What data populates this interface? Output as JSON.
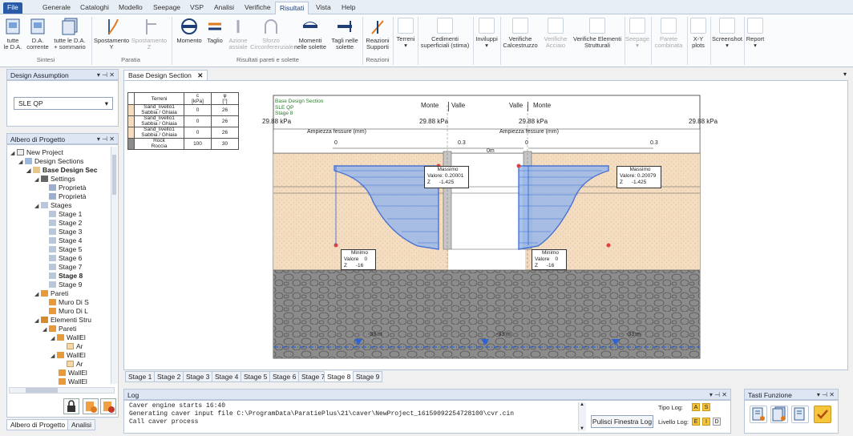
{
  "ribbon_tabs": [
    "File",
    "Generale",
    "Cataloghi",
    "Modello",
    "Seepage",
    "VSP",
    "Analisi",
    "Verifiche",
    "Risultati",
    "Vista",
    "Help"
  ],
  "active_tab": "Risultati",
  "ribbon": {
    "sintesi": {
      "group": "Sintesi",
      "b1": "tutte\nle D.A.",
      "b2": "D.A.\ncorrente",
      "b3": "tutte le D.A.\n+ sommario"
    },
    "paratia": {
      "group": "Paratia",
      "b1": "Spostamento\nY",
      "b2": "Spostamento\nZ"
    },
    "risultati": {
      "group": "Risultati pareti e solette",
      "b1": "Momento",
      "b2": "Taglio",
      "b3": "Azione\nassiale",
      "b4": "Sforzo\nCirconferenziale",
      "b5": "Momenti\nnelle solette",
      "b6": "Tagli nelle\nsolette"
    },
    "reazioni": {
      "group": "Reazioni",
      "b1": "Reazioni\nSupporti"
    },
    "others": [
      "Terreni",
      "Cedimenti\nsuperficiali (stima)",
      "Inviluppi",
      "Verifiche\nCalcestruzzo",
      "Verifiche\nAcciaio",
      "Verifiche Elementi\nStrutturali",
      "Seepage",
      "Parete\ncombinata",
      "X-Y\nplots",
      "Screenshot",
      "Report"
    ]
  },
  "design_assumption": {
    "title": "Design Assumption",
    "value": "SLE QP"
  },
  "tree": {
    "title": "Albero di Progetto",
    "items": [
      "New Project",
      "Design Sections",
      "Base Design Sec",
      "Settings",
      "Proprietà",
      "Proprietà",
      "Stages",
      "Stage 1",
      "Stage 2",
      "Stage 3",
      "Stage 4",
      "Stage 5",
      "Stage 6",
      "Stage 7",
      "Stage 8",
      "Stage 9",
      "Pareti",
      "Muro Di S",
      "Muro Di L",
      "Elementi Stru",
      "Pareti",
      "WallEl",
      "Ar",
      "WallEl",
      "Ar",
      "WallEl",
      "WallEl"
    ]
  },
  "left_tabs": [
    "Albero di Progetto",
    "Analisi"
  ],
  "document_tab": "Base Design Section",
  "soil_table": {
    "headers": [
      "Terreni",
      "c\n[kPa]",
      "φ\n[°]"
    ],
    "rows": [
      {
        "name": "Sand_livello1\nSabbia / Ghiaia",
        "c": "0",
        "phi": "26"
      },
      {
        "name": "Sand_livello1\nSabbia / Ghiaia",
        "c": "0",
        "phi": "26"
      },
      {
        "name": "Sand_livello1\nSabbia / Ghiaia",
        "c": "0",
        "phi": "26"
      },
      {
        "name": "Rock\nRoccia",
        "c": "100",
        "phi": "30"
      }
    ]
  },
  "drawing": {
    "header": "Base Design Section\nSLE QP\nStage 8",
    "monte": "Monte",
    "valle": "Valle",
    "loads": [
      "29.88 kPa",
      "29.88 kPa",
      "29.88 kPa",
      "29.88 kPa"
    ],
    "chart_title": "Ampiezza fessure (mm)",
    "scale_left": [
      "0",
      "0.3"
    ],
    "scale_mid": "0m",
    "scale_right": [
      "0",
      "0.3"
    ],
    "max_left": {
      "title": "Massimo",
      "valore": "Valore: 0.20001",
      "z": "Z      -1.425"
    },
    "max_right": {
      "title": "Massimo",
      "valore": "Valore: 0.20079",
      "z": "Z      -1.425"
    },
    "min_left": {
      "title": "Minimo",
      "valore": "Valore    0",
      "z": "Z      -16"
    },
    "min_right": {
      "title": "Minimo",
      "valore": "Valore    0",
      "z": "Z      -16"
    },
    "water": [
      "-33 m",
      "-33 m",
      "-33 m"
    ],
    "colors": {
      "sand": "#f3dcc0",
      "rock": "#8c8c8c",
      "crack": "#2c63d6",
      "wall": "#c6c6c6"
    }
  },
  "stage_tabs": [
    "Stage 1",
    "Stage 2",
    "Stage 3",
    "Stage 4",
    "Stage 5",
    "Stage 6",
    "Stage 7",
    "Stage 8",
    "Stage 9"
  ],
  "active_stage": "Stage 8",
  "log": {
    "title": "Log",
    "lines": [
      "Caver engine starts 16:40",
      "Generating caver input file C:\\ProgramData\\ParatiePlus\\21\\caver\\NewProject_16159092254728100\\cvr.cin",
      "Call caver process"
    ],
    "clear_button": "Pulisci Finestra Log",
    "tipo_log": "Tipo Log:",
    "livello_log": "Livello Log:",
    "tipo_buttons": [
      "A",
      "S"
    ],
    "livello_buttons": [
      "E",
      "I",
      "D"
    ]
  },
  "tasti": {
    "title": "Tasti Funzione"
  }
}
